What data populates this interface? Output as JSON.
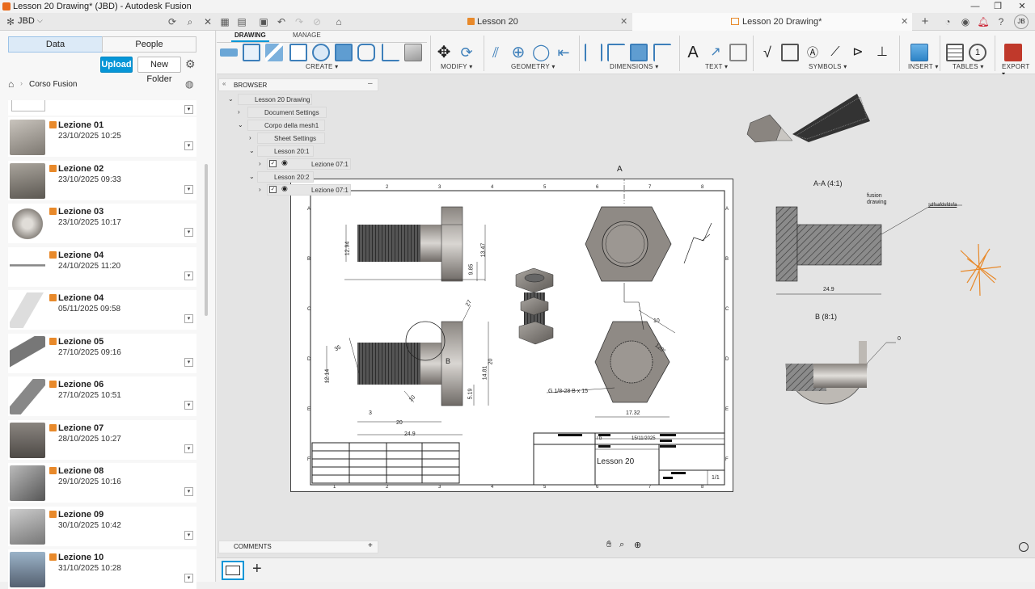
{
  "window": {
    "title": "Lesson 20 Drawing* (JBD) - Autodesk Fusion",
    "controls": [
      "—",
      "❐",
      "✕"
    ]
  },
  "tabs": {
    "team": "JBD",
    "tab1": "Lesson 20",
    "tab2": "Lesson 20 Drawing*"
  },
  "data_panel": {
    "seg_data": "Data",
    "seg_people": "People",
    "upload": "Upload",
    "new_folder": "New Folder",
    "breadcrumb": "Corso Fusion",
    "items": [
      {
        "name": "Lezione 01",
        "date": "23/10/2025 10:25"
      },
      {
        "name": "Lezione 02",
        "date": "23/10/2025 09:33"
      },
      {
        "name": "Lezione 03",
        "date": "23/10/2025 10:17"
      },
      {
        "name": "Lezione 04",
        "date": "24/10/2025 11:20"
      },
      {
        "name": "Lezione 04",
        "date": "05/11/2025 09:58"
      },
      {
        "name": "Lezione 05",
        "date": "27/10/2025 09:16"
      },
      {
        "name": "Lezione 06",
        "date": "27/10/2025 10:51"
      },
      {
        "name": "Lezione 07",
        "date": "28/10/2025 10:27"
      },
      {
        "name": "Lezione 08",
        "date": "29/10/2025 10:16"
      },
      {
        "name": "Lezione 09",
        "date": "30/10/2025 10:42"
      },
      {
        "name": "Lezione 10",
        "date": "31/10/2025 10:28"
      }
    ]
  },
  "ribbon": {
    "tab_drawing": "DRAWING",
    "tab_manage": "MANAGE",
    "groups": {
      "create": "CREATE ▾",
      "modify": "MODIFY ▾",
      "geometry": "GEOMETRY ▾",
      "dimensions": "DIMENSIONS ▾",
      "text": "TEXT ▾",
      "symbols": "SYMBOLS ▾",
      "insert": "INSERT ▾",
      "tables": "TABLES ▾",
      "export": "EXPORT ▾"
    }
  },
  "browser": {
    "title": "BROWSER",
    "rows": [
      "Lesson 20 Drawing",
      "Document Settings",
      "Corpo della mesh1",
      "Sheet Settings",
      "Lesson 20:1",
      "Lezione 07:1",
      "Lesson 20:2",
      "Lezione 07:1"
    ]
  },
  "drawing": {
    "section_label": "A",
    "section_view_title": "A-A (4:1)",
    "detail_view_title": "B (8:1)",
    "note_fusion": "fusion",
    "note_drawing": "drawing",
    "note_leader": "sdfsafdsfdsfa",
    "detail_dim": "0",
    "section_dim": "24.9",
    "dims": {
      "d1": "12.94",
      "d2": "13.47",
      "d3": "9.85",
      "d4": "12.14",
      "d5": "14.81",
      "d6": "20",
      "d7": "5.19",
      "d8": "20",
      "d9": "24.9",
      "d10": "3",
      "d11": "35",
      "d12": "10",
      "d13": "17.32",
      "d14": "120°",
      "d15": "10",
      "d16": "27",
      "d17": "B"
    },
    "thread_note": "G 1/8-28 B x 15",
    "title_block": {
      "date": "15/11/2025",
      "title": "Lesson 20",
      "sheet": "1/1",
      "small": "l b"
    },
    "border_cols": [
      "1",
      "2",
      "3",
      "4",
      "5",
      "6",
      "7",
      "8"
    ],
    "border_rows": [
      "A",
      "B",
      "C",
      "D",
      "E",
      "F"
    ]
  },
  "comments": {
    "label": "COMMENTS"
  },
  "colors": {
    "accent": "#0696d7",
    "upload": "#0696d7",
    "cube": "#e8892a",
    "brand": "#e86a1c"
  }
}
